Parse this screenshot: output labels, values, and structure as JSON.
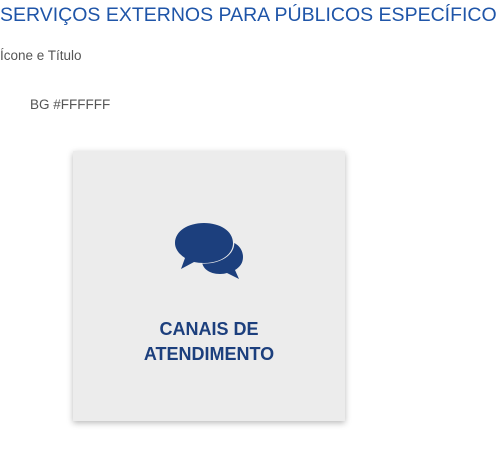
{
  "header": {
    "title": "SERVIÇOS EXTERNOS PARA PÚBLICOS ESPECÍFICOS",
    "subtitle": "Ícone e Título",
    "bg_note": "BG #FFFFFF"
  },
  "card": {
    "icon": "comments-icon",
    "label_line1": "CANAIS DE",
    "label_line2": "ATENDIMENTO"
  },
  "colors": {
    "title": "#1f55a8",
    "card_background": "#ececec",
    "card_text": "#1c3f7d",
    "icon": "#1c3f7d"
  }
}
